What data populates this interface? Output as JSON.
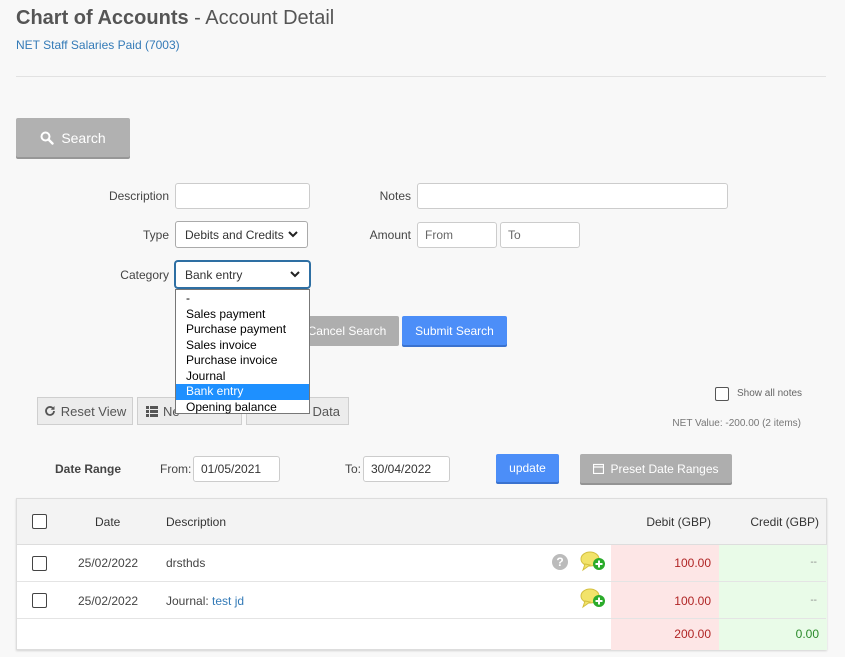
{
  "header": {
    "title_bold": "Chart of Accounts",
    "title_rest": "- Account Detail",
    "subtitle": "NET Staff Salaries Paid (7003)"
  },
  "search_button": {
    "label": "Search",
    "icon": "search-icon"
  },
  "filters": {
    "description": {
      "label": "Description",
      "value": ""
    },
    "notes": {
      "label": "Notes",
      "value": ""
    },
    "type": {
      "label": "Type",
      "value": "Debits and Credits"
    },
    "amount": {
      "label": "Amount",
      "from_placeholder": "From",
      "to_placeholder": "To"
    },
    "category": {
      "label": "Category",
      "value": "Bank entry"
    }
  },
  "category_options": [
    "-",
    "Sales payment",
    "Purchase payment",
    "Sales invoice",
    "Purchase invoice",
    "Journal",
    "Bank entry",
    "Opening balance"
  ],
  "category_selected": "Bank entry",
  "search_actions": {
    "cancel": "Cancel Search",
    "submit": "Submit Search"
  },
  "view_buttons": {
    "reset": "Reset View",
    "new": "Ne",
    "data": "Data"
  },
  "show_all_notes": {
    "label": "Show all notes",
    "checked": false
  },
  "net_value": "NET Value: -200.00 (2 items)",
  "date_range": {
    "label": "Date Range",
    "from_label": "From:",
    "from_value": "01/05/2021",
    "to_label": "To:",
    "to_value": "30/04/2022",
    "update": "update",
    "presets": "Preset Date Ranges"
  },
  "table": {
    "headers": {
      "date": "Date",
      "description": "Description",
      "debit": "Debit (GBP)",
      "credit": "Credit (GBP)"
    },
    "rows": [
      {
        "date": "25/02/2022",
        "desc_prefix": "drsthds",
        "desc_link": "",
        "debit": "100.00",
        "credit": "--",
        "help": "?"
      },
      {
        "date": "25/02/2022",
        "desc_prefix": "Journal:",
        "desc_link": "test jd",
        "debit": "100.00",
        "credit": "--",
        "help": ""
      }
    ],
    "totals": {
      "debit": "200.00",
      "credit": "0.00"
    }
  },
  "colors": {
    "accent": "#4c8ef8",
    "debit_bg": "#fde6e6",
    "credit_bg": "#e9fbe8",
    "debit_text": "#b02525",
    "credit_text": "#2a8a2a",
    "link": "#337ab7"
  }
}
